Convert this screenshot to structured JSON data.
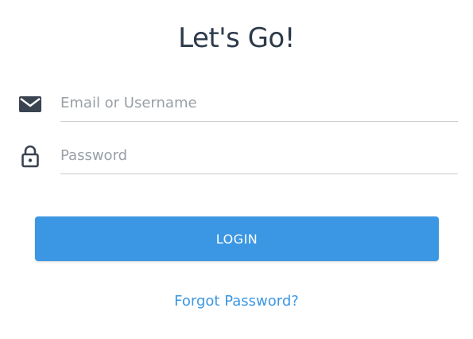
{
  "header": {
    "title": "Let's Go!"
  },
  "form": {
    "email": {
      "placeholder": "Email or Username",
      "value": "",
      "icon": "envelope-icon"
    },
    "password": {
      "placeholder": "Password",
      "value": "",
      "icon": "lock-icon"
    },
    "login_label": "LOGIN",
    "forgot_label": "Forgot Password?"
  },
  "colors": {
    "accent": "#3b97e3",
    "title": "#2d3a4a",
    "icon": "#3a4350",
    "divider": "#c8ccd0"
  }
}
